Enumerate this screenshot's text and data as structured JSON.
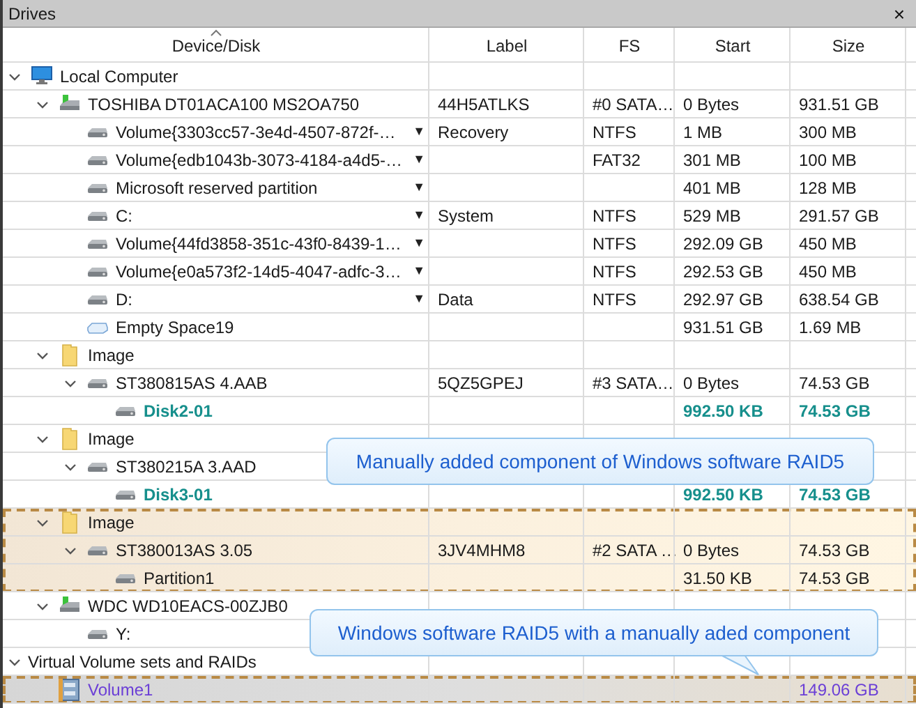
{
  "panel": {
    "title": "Drives",
    "close": "×"
  },
  "columns": [
    {
      "label": "Device/Disk",
      "sorted": true
    },
    {
      "label": "Label"
    },
    {
      "label": "FS"
    },
    {
      "label": "Start"
    },
    {
      "label": "Size"
    }
  ],
  "tree": [
    {
      "name": "Local Computer",
      "kind": "computer",
      "expanded": true,
      "selected": false,
      "children": [
        {
          "name": "TOSHIBA DT01ACA100 MS2OA750",
          "kind": "disk",
          "expanded": true,
          "selected": false,
          "label": "44H5ATLKS",
          "fs": "#0 SATA…",
          "start": "0 Bytes",
          "size": "931.51 GB",
          "children": [
            {
              "name": "Volume{3303cc57-3e4d-4507-872f-…",
              "dropdown": "▼",
              "kind": "volume",
              "selected": false,
              "label": "Recovery",
              "fs": "NTFS",
              "start": "1 MB",
              "size": "300 MB"
            },
            {
              "name": "Volume{edb1043b-3073-4184-a4d5-…",
              "dropdown": "▼",
              "kind": "volume",
              "selected": false,
              "fs": "FAT32",
              "start": "301 MB",
              "size": "100 MB"
            },
            {
              "name": "Microsoft reserved partition",
              "dropdown": "▼",
              "kind": "volume",
              "selected": false,
              "start": "401 MB",
              "size": "128 MB"
            },
            {
              "name": "C:",
              "dropdown": "▼",
              "kind": "volume",
              "selected": false,
              "label": "System",
              "fs": "NTFS",
              "start": "529 MB",
              "size": "291.57 GB"
            },
            {
              "name": "Volume{44fd3858-351c-43f0-8439-1…",
              "dropdown": "▼",
              "kind": "volume",
              "selected": false,
              "fs": "NTFS",
              "start": "292.09 GB",
              "size": "450 MB"
            },
            {
              "name": "Volume{e0a573f2-14d5-4047-adfc-3…",
              "dropdown": "▼",
              "kind": "volume",
              "selected": false,
              "fs": "NTFS",
              "start": "292.53 GB",
              "size": "450 MB"
            },
            {
              "name": "D:",
              "dropdown": "▼",
              "kind": "volume",
              "selected": false,
              "label": "Data",
              "fs": "NTFS",
              "start": "292.97 GB",
              "size": "638.54 GB"
            },
            {
              "name": "Empty Space19",
              "kind": "empty",
              "selected": false,
              "start": "931.51 GB",
              "size": "1.69 MB"
            }
          ]
        },
        {
          "name": "Image",
          "kind": "folder",
          "expanded": true,
          "selected": false,
          "children": [
            {
              "name": "ST380815AS 4.AAB",
              "kind": "volume",
              "expanded": true,
              "selected": false,
              "label": "5QZ5GPEJ",
              "fs": "#3 SATA…",
              "start": "0 Bytes",
              "size": "74.53 GB",
              "children": [
                {
                  "name": "Disk2-01",
                  "kind": "component",
                  "selected": false,
                  "start": "992.50 KB",
                  "size": "74.53 GB"
                }
              ]
            }
          ]
        },
        {
          "name": "Image",
          "kind": "folder",
          "expanded": true,
          "selected": false,
          "children": [
            {
              "name": "ST380215A 3.AAD",
              "kind": "volume",
              "expanded": true,
              "selected": false,
              "children": [
                {
                  "name": "Disk3-01",
                  "kind": "component",
                  "selected": false,
                  "start": "992.50 KB",
                  "size": "74.53 GB"
                }
              ]
            }
          ]
        },
        {
          "name": "Image",
          "kind": "folder",
          "expanded": true,
          "marked": true,
          "selected": false,
          "children": [
            {
              "name": "ST380013AS 3.05",
              "kind": "volume",
              "expanded": true,
              "selected": false,
              "label": "3JV4MHM8",
              "fs": "#2 SATA …",
              "start": "0 Bytes",
              "size": "74.53 GB",
              "children": [
                {
                  "name": "Partition1",
                  "kind": "volume",
                  "selected": false,
                  "start": "31.50 KB",
                  "size": "74.53 GB"
                }
              ]
            }
          ]
        },
        {
          "name": "WDC WD10EACS-00ZJB0",
          "kind": "disk",
          "expanded": true,
          "selected": false,
          "children": [
            {
              "name": "Y:",
              "kind": "volume",
              "selected": false
            }
          ]
        }
      ]
    },
    {
      "name": "Virtual Volume sets and RAIDs",
      "kind": "group",
      "expanded": true,
      "selected": false,
      "children": [
        {
          "name": "Volume1",
          "kind": "raid",
          "marked": true,
          "selected": true,
          "size": "149.06 GB"
        }
      ]
    }
  ],
  "callouts": [
    {
      "text": "Manually added component of Windows software RAID5"
    },
    {
      "text": "Windows software RAID5 with a manually aded component"
    }
  ]
}
